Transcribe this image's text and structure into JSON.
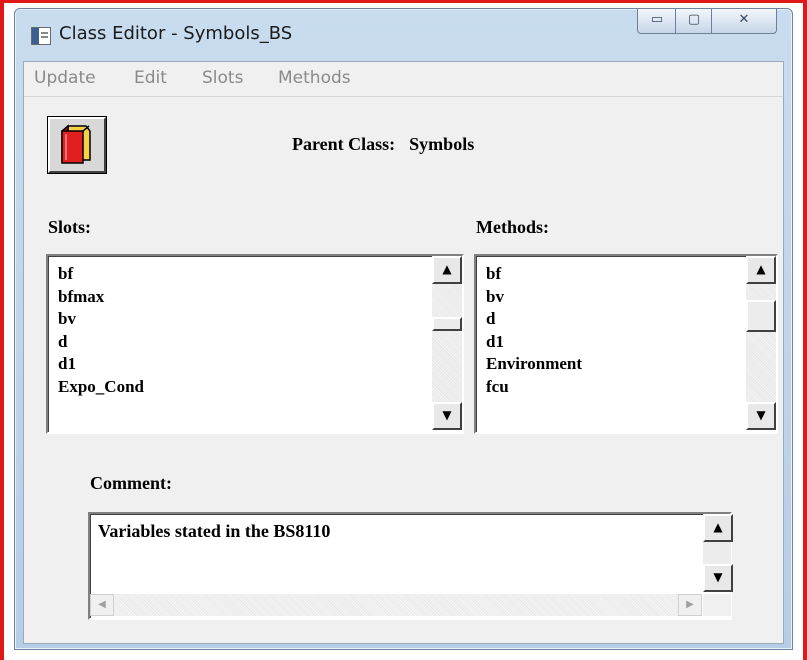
{
  "window": {
    "title": "Class Editor - Symbols_BS",
    "controls": {
      "minimize": "▭",
      "maximize": "▢",
      "close": "✕"
    }
  },
  "menu": [
    "Update",
    "Edit",
    "Slots",
    "Methods"
  ],
  "toolbar": {
    "book_icon": "red-book-icon"
  },
  "parent_class": {
    "label": "Parent Class:",
    "value": "Symbols"
  },
  "slots": {
    "label": "Slots:",
    "items": [
      "bf",
      "bfmax",
      "bv",
      "d",
      "d1",
      "Expo_Cond"
    ]
  },
  "methods": {
    "label": "Methods:",
    "items": [
      "bf",
      "bv",
      "d",
      "d1",
      "Environment",
      "fcu"
    ]
  },
  "comment": {
    "label": "Comment:",
    "text": "Variables stated in the BS8110"
  },
  "scroll_glyphs": {
    "up": "▲",
    "down": "▼",
    "left": "◀",
    "right": "▶"
  }
}
